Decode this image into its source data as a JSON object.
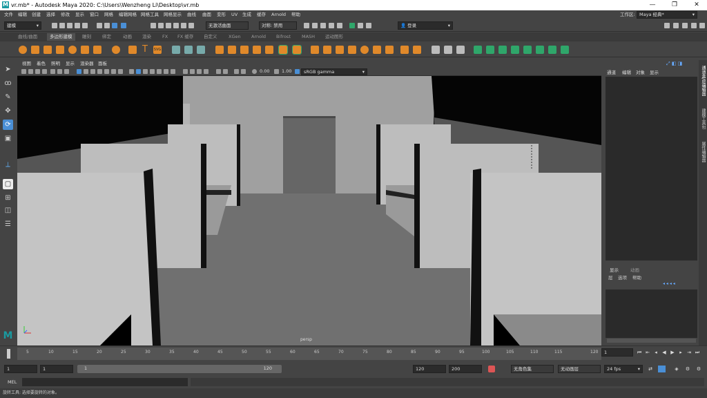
{
  "window": {
    "title": "vr.mb* - Autodesk Maya 2020: C:\\Users\\Wenzheng Li\\Desktop\\vr.mb",
    "minimize": "—",
    "maximize": "❐",
    "close": "✕"
  },
  "menubar": {
    "items": [
      "文件",
      "编辑",
      "创建",
      "选择",
      "修改",
      "显示",
      "窗口",
      "网格",
      "编辑网格",
      "网格工具",
      "网格显示",
      "曲线",
      "曲面",
      "变形",
      "UV",
      "生成",
      "缓存",
      "Arnold",
      "帮助"
    ],
    "workspace_label": "工作区:",
    "workspace_value": "Maya 经典*"
  },
  "statusline": {
    "mode_menu": "建模",
    "live_surface": "无激活曲面",
    "symmetry": "对称: 禁用",
    "login": "登录"
  },
  "shelf": {
    "tabs": [
      "曲线/曲面",
      "多边形建模",
      "雕刻",
      "绑定",
      "动画",
      "渲染",
      "FX",
      "FX 缓存",
      "自定义",
      "XGen",
      "Arnold",
      "Bifrost",
      "MASH",
      "运动图形"
    ],
    "active_index": 1
  },
  "panel": {
    "menus": [
      "视图",
      "着色",
      "照明",
      "显示",
      "渲染器",
      "面板"
    ],
    "exposure": "0.00",
    "gamma": "1.00",
    "color_space": "sRGB gamma",
    "camera_label": "persp"
  },
  "channelbox": {
    "menus": [
      "通道",
      "编辑",
      "对象",
      "显示"
    ],
    "layer_tabs": [
      "显示",
      "动画"
    ],
    "layer_menus": [
      "层",
      "选项",
      "帮助"
    ]
  },
  "side_tabs": [
    "通道盒/层编辑器",
    "建模工具包",
    "属性编辑器"
  ],
  "timeline": {
    "ticks": [
      "1",
      "5",
      "10",
      "15",
      "20",
      "25",
      "30",
      "35",
      "40",
      "45",
      "50",
      "55",
      "60",
      "65",
      "70",
      "75",
      "80",
      "85",
      "90",
      "95",
      "100",
      "105",
      "110",
      "115",
      "120"
    ],
    "current_frame": "1"
  },
  "range": {
    "start": "1",
    "anim_start": "1",
    "playback_start": "1",
    "playback_end": "120",
    "end": "120",
    "anim_end": "200",
    "character_set": "无角色集",
    "anim_layer": "无动画层",
    "fps": "24 fps"
  },
  "command_line": {
    "label": "MEL"
  },
  "status": {
    "help": "旋转工具: 选择要旋转的对象。"
  },
  "colors": {
    "background": "#444444",
    "viewport_bg": "#000000",
    "shelf_orange": "#e0892a",
    "shelf_green": "#2fa66a",
    "highlight_blue": "#4a8fd6"
  }
}
